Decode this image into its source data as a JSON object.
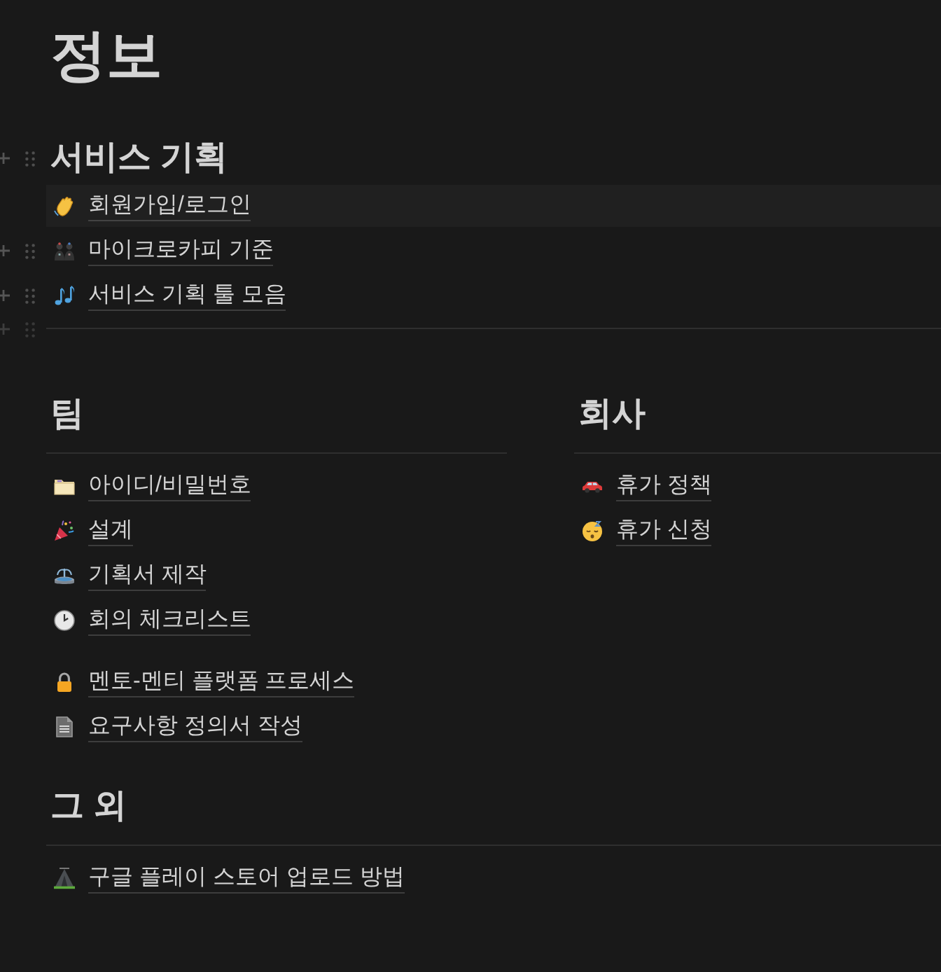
{
  "title": "정보",
  "service_section": {
    "heading": "서비스 기획",
    "heading_handle": true,
    "items": [
      {
        "label": "회원가입/로그인",
        "highlighted": true,
        "handle": false
      },
      {
        "label": "마이크로카피 기준",
        "highlighted": false,
        "handle": true
      },
      {
        "label": "서비스 기획 툴 모음",
        "highlighted": false,
        "handle": true
      }
    ],
    "divider_handle": true
  },
  "columns": [
    {
      "heading": "팀",
      "groups": [
        {
          "items": [
            {
              "label": "아이디/비밀번호"
            },
            {
              "label": "설계"
            },
            {
              "label": "기획서 제작"
            },
            {
              "label": "회의 체크리스트"
            }
          ]
        },
        {
          "items": [
            {
              "label": "멘토-멘티 플랫폼 프로세스"
            },
            {
              "label": "요구사항 정의서 작성"
            }
          ]
        }
      ]
    },
    {
      "heading": "회사",
      "groups": [
        {
          "items": [
            {
              "label": "휴가 정책"
            },
            {
              "label": "휴가 신청"
            }
          ]
        }
      ]
    }
  ],
  "other_section": {
    "heading": "그 외",
    "items": [
      {
        "label": "구글 플레이 스토어 업로드 방법"
      }
    ]
  }
}
